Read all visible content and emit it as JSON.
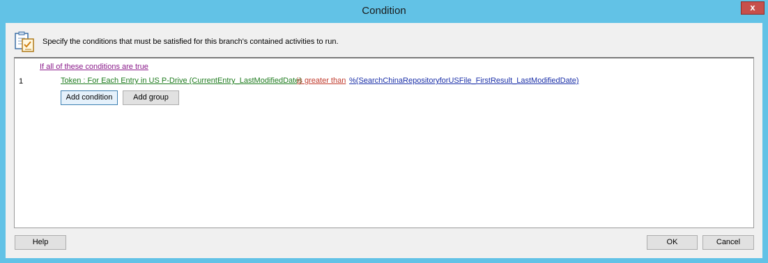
{
  "window": {
    "title": "Condition",
    "close_label": "x"
  },
  "header": {
    "instructions": "Specify the conditions that must be satisfied for this branch's contained activities to run."
  },
  "editor": {
    "group_link": "If all of these conditions are true",
    "conditions": [
      {
        "index": "1",
        "token": "Token : For Each Entry in US P-Drive (CurrentEntry_LastModifiedDate)",
        "operator": "is greater than",
        "value": "%(SearchChinaRepositoryforUSFile_FirstResult_LastModifiedDate)"
      }
    ],
    "add_condition_label": "Add condition",
    "add_group_label": "Add group"
  },
  "footer": {
    "help_label": "Help",
    "ok_label": "OK",
    "cancel_label": "Cancel"
  },
  "colors": {
    "titlebar": "#62c2e6",
    "close": "#c74f4b",
    "token": "#1e7b1e",
    "operator": "#c0392b",
    "value": "#1a2fa8",
    "group_link": "#8a1a8a"
  },
  "icons": {
    "header": "checklist-icon",
    "close": "close-icon"
  }
}
